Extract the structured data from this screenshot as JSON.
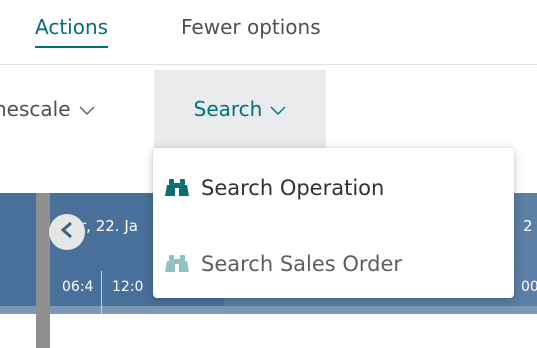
{
  "tabs": [
    {
      "label": "Actions",
      "active": true
    },
    {
      "label": "Fewer options",
      "active": false
    }
  ],
  "action_bar": {
    "timescale_label": "nescale",
    "search_label": "Search"
  },
  "timeline": {
    "date_left": "r, 22. Ja",
    "date_right": "2",
    "times": [
      "06:4",
      "12:0",
      "00"
    ]
  },
  "search_menu": {
    "items": [
      {
        "label": "Search Operation",
        "icon": "binoculars-icon",
        "enabled": true
      },
      {
        "label": "Search Sales Order",
        "icon": "binoculars-icon",
        "enabled": false
      }
    ]
  },
  "colors": {
    "accent": "#00707a",
    "timeline": "#5b7fa5",
    "timeline_dark": "#49709a"
  }
}
